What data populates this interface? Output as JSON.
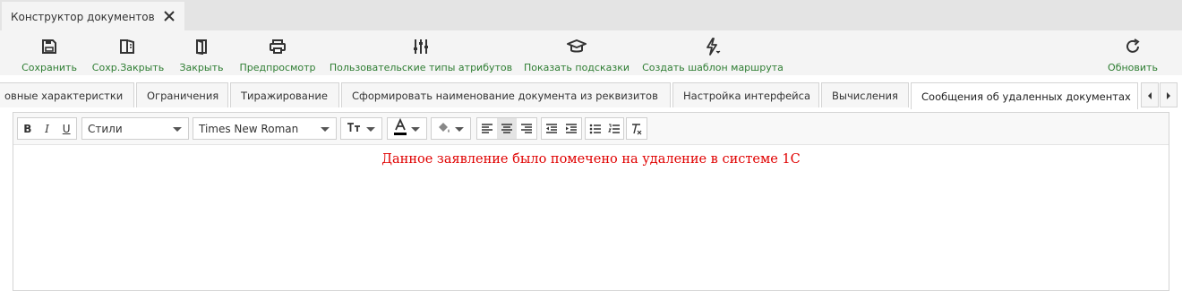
{
  "document_tab": {
    "title": "Конструктор документов",
    "close_icon": "close-icon"
  },
  "toolbar": {
    "buttons": [
      {
        "label": "Сохранить",
        "icon": "save-icon"
      },
      {
        "label": "Сохр.Закрыть",
        "icon": "book-icon"
      },
      {
        "label": "Закрыть",
        "icon": "door-icon"
      },
      {
        "label": "Предпросмотр",
        "icon": "printer-icon"
      },
      {
        "label": "Пользовательские типы атрибутов",
        "icon": "sliders-icon"
      },
      {
        "label": "Показать подсказки",
        "icon": "graduation-cap-icon"
      },
      {
        "label": "Создать шаблон маршрута",
        "icon": "bolt-icon"
      },
      {
        "label": "Обновить",
        "icon": "refresh-icon"
      }
    ],
    "label_color": "#2e7d32"
  },
  "form_tabs": [
    {
      "label": "овные характеристки"
    },
    {
      "label": "Ограничения"
    },
    {
      "label": "Тиражирование"
    },
    {
      "label": "Сформировать наименование документа из реквизитов"
    },
    {
      "label": "Настройка интерфейса"
    },
    {
      "label": "Вычисления"
    },
    {
      "label": "Сообщения об удаленных документах",
      "active": true
    }
  ],
  "editor": {
    "toolbar": {
      "bold": "B",
      "italic": "I",
      "underline": "U",
      "styles_select": "Стили",
      "font_select": "Times New Roman",
      "font_size_icon": "font-size-icon",
      "text_color_icon": "text-color-icon",
      "text_color": "#000000",
      "background_color_icon": "paint-bucket-icon",
      "align_icons": [
        "align-left-icon",
        "align-center-icon",
        "align-right-icon"
      ],
      "indent_icons": [
        "outdent-icon",
        "indent-icon"
      ],
      "list_icons": [
        "bulleted-list-icon",
        "numbered-list-icon"
      ],
      "clear_format_icon": "clear-format-icon"
    },
    "content": {
      "text": "Данное заявление было помечено на удаление в системе 1С",
      "color": "#e00000",
      "font": "Times New Roman"
    }
  }
}
